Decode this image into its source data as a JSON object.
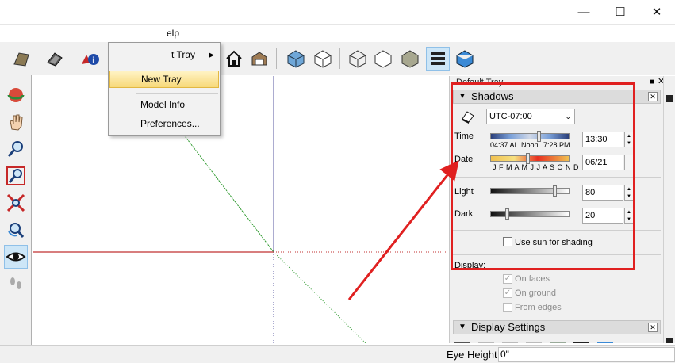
{
  "window": {
    "min_glyph": "—",
    "max_glyph": "☐",
    "close_glyph": "✕"
  },
  "menu": {
    "help_partial": "elp"
  },
  "dropdown": {
    "items": [
      {
        "label": "t Tray",
        "has_submenu": true
      },
      {
        "label": "New Tray",
        "highlighted": true
      },
      {
        "label": "Model Info"
      },
      {
        "label": "Preferences..."
      }
    ]
  },
  "toolbar": {
    "icons": [
      "paint-bucket-icon",
      "components-icon",
      "model-info-icon",
      "home-view-icon",
      "warehouse-icon",
      "iso-view-icon",
      "top-view-icon",
      "front-view-icon",
      "right-view-icon",
      "back-view-icon",
      "xray-style-icon",
      "shaded-style-icon",
      "monochrome-style-icon",
      "texture-style-icon"
    ]
  },
  "left_toolbar": {
    "icons": [
      "orbit-icon",
      "pan-icon",
      "zoom-icon",
      "zoom-window-icon",
      "zoom-extents-icon",
      "previous-view-icon",
      "look-around-icon",
      "walk-icon"
    ]
  },
  "tray": {
    "title": "Default Tray",
    "pin_glyph": "📌",
    "shadows": {
      "header": "Shadows",
      "timezone": "UTC-07:00",
      "time_label": "Time",
      "time_start": "04:37 AI",
      "time_noon": "Noon",
      "time_end": "7:28 PM",
      "time_value": "13:30",
      "date_label": "Date",
      "months": "J F M A M J J A S O N D",
      "date_value": "06/21",
      "light_label": "Light",
      "light_value": "80",
      "dark_label": "Dark",
      "dark_value": "20",
      "use_sun_label": "Use sun for shading",
      "display_label": "Display:",
      "on_faces": "On faces",
      "on_ground": "On ground",
      "from_edges": "From edges"
    },
    "display_settings": {
      "header": "Display Settings"
    }
  },
  "status": {
    "label": "Eye Height",
    "value": "0\""
  },
  "colors": {
    "highlight": "#e02020",
    "menu_highlight": "#f7d97a",
    "axis_red": "#c03030",
    "axis_green": "#2e9a2e",
    "axis_blue": "#5a5aa0"
  }
}
